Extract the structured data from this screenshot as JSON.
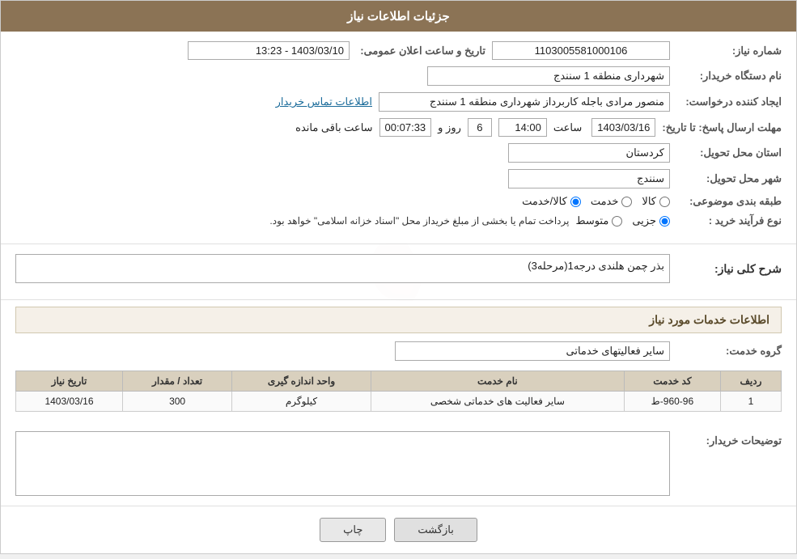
{
  "header": {
    "title": "جزئیات اطلاعات نیاز"
  },
  "info": {
    "shomareNiaz_label": "شماره نیاز:",
    "shomareNiaz_value": "1103005581000106",
    "tarikhLabel": "تاریخ و ساعت اعلان عمومی:",
    "tarikhValue": "1403/03/10 - 13:23",
    "namDastgahLabel": "نام دستگاه خریدار:",
    "namDastgahValue": "شهرداری منطقه 1 سنندج",
    "ijadKannadeLabel": "ایجاد کننده درخواست:",
    "ijadKannadeValue": "منصور مرادی باجله کاربرداز شهرداری منطقه 1 سنندج",
    "ettelaatTamasLabel": "اطلاعات تماس خریدار",
    "mohlat_label": "مهلت ارسال پاسخ: تا تاریخ:",
    "mohlatDate": "1403/03/16",
    "mohlatSaat": "14:00",
    "mohlatRoz": "6",
    "mohlatBaqi": "00:07:33",
    "roozLabel": "روز و",
    "saatLabel": "ساعت",
    "baghimandaLabel": "ساعت باقی مانده",
    "ostan_label": "استان محل تحویل:",
    "ostanValue": "کردستان",
    "shahr_label": "شهر محل تحویل:",
    "shahrValue": "سنندج",
    "tabaghe_label": "طبقه بندی موضوعی:",
    "tabagheOptions": [
      {
        "label": "کالا",
        "value": "kala"
      },
      {
        "label": "خدمت",
        "value": "khedmat"
      },
      {
        "label": "کالا/خدمت",
        "value": "kala_khedmat"
      }
    ],
    "tabagheSelected": "kala",
    "noeFaraind_label": "نوع فرآیند خرید :",
    "noeFaraindOptions": [
      {
        "label": "جزیی",
        "value": "jozi"
      },
      {
        "label": "متوسط",
        "value": "mottavaset"
      }
    ],
    "noeFaraindSelected": "jozi",
    "noeFaraindNote": "پرداخت تمام یا بخشی از مبلغ خریداز محل \"اسناد خزانه اسلامی\" خواهد بود."
  },
  "sharh": {
    "section_title": "شرح کلی نیاز:",
    "value": "بذر چمن هلندی درجه1(مرحله3)"
  },
  "khadamat": {
    "section_title": "اطلاعات خدمات مورد نیاز",
    "grooh_label": "گروه خدمت:",
    "groohValue": "سایر فعالیتهای خدماتی",
    "table": {
      "headers": [
        "ردیف",
        "کد خدمت",
        "نام خدمت",
        "واحد اندازه گیری",
        "تعداد / مقدار",
        "تاریخ نیاز"
      ],
      "rows": [
        {
          "radif": "1",
          "kodKhedmat": "960-96-ط",
          "namKhedmat": "سایر فعالیت های خدماتی شخصی",
          "vahed": "کیلوگرم",
          "tedad": "300",
          "tarikh": "1403/03/16"
        }
      ]
    }
  },
  "tozihat": {
    "label": "توضیحات خریدار:",
    "value": ""
  },
  "buttons": {
    "print": "چاپ",
    "back": "بازگشت"
  }
}
